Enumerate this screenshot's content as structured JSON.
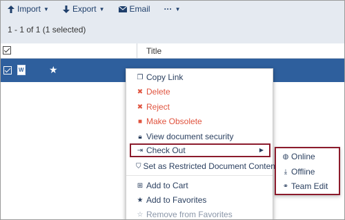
{
  "toolbar": {
    "import_label": "Import",
    "export_label": "Export",
    "email_label": "Email",
    "more_label": "···"
  },
  "selection_count": "1 - 1 of 1 (1 selected)",
  "table": {
    "columns": [
      "Title"
    ],
    "row": {
      "file_type": "W"
    }
  },
  "context_menu": {
    "items": [
      "Copy Link",
      "Delete",
      "Reject",
      "Make Obsolete",
      "View document security",
      "Check Out",
      "Set as Restricted Document Content",
      "Add to Cart",
      "Add to Favorites",
      "Remove from Favorites"
    ]
  },
  "checkout_submenu": {
    "items": [
      "Online",
      "Offline",
      "Team Edit"
    ]
  },
  "colors": {
    "toolbar_bg": "#e5eaf1",
    "selected_row": "#2e5f9d",
    "danger": "#e0533e",
    "highlight_border": "#8b1a2b"
  }
}
